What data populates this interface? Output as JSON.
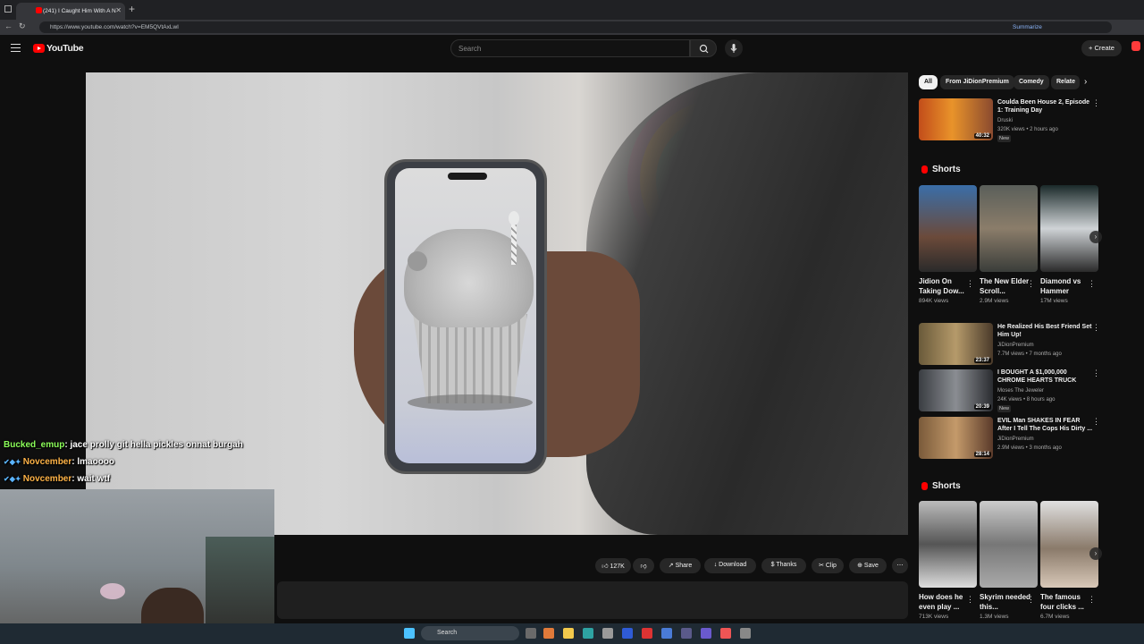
{
  "browser": {
    "tab_title": "(241) I Caught Him With A N",
    "url": "https://www.youtube.com/watch?v=EM5QVtAxLwI",
    "summarize_label": "Summarize"
  },
  "youtube": {
    "logo_text": "YouTube",
    "search_placeholder": "Search",
    "create_label": "Create"
  },
  "video_actions": {
    "like_count": "127K",
    "share": "Share",
    "download": "Download",
    "thanks": "Thanks",
    "clip": "Clip",
    "save": "Save"
  },
  "sidebar": {
    "chips": [
      "All",
      "From JiDionPremium",
      "Comedy",
      "Relate"
    ],
    "top_video": {
      "title": "Coulda Been House 2, Episode 1: Training Day",
      "channel": "Druski",
      "meta": "320K views • 2 hours ago",
      "badge": "New",
      "duration": "40:32"
    },
    "shorts_heading_1": "Shorts",
    "shorts_1": [
      {
        "title": "Jidion On Taking Dow...",
        "views": "894K views"
      },
      {
        "title": "The New Elder Scroll...",
        "views": "2.9M views"
      },
      {
        "title": "Diamond vs Hammer",
        "views": "17M views"
      }
    ],
    "videos": [
      {
        "title": "He Realized His Best Friend Set Him Up!",
        "channel": "JiDionPremium",
        "meta": "7.7M views • 7 months ago",
        "duration": "23:37",
        "badge": ""
      },
      {
        "title": "I BOUGHT A $1,000,000 CHROME HEARTS TRUCK",
        "channel": "Moses The Jeweler",
        "meta": "24K views • 8 hours ago",
        "duration": "20:39",
        "badge": "New"
      },
      {
        "title": "EVIL Man SHAKES IN FEAR After I Tell The Cops His Dirty ...",
        "channel": "JiDionPremium",
        "meta": "2.9M views • 3 months ago",
        "duration": "28:14",
        "badge": ""
      }
    ],
    "shorts_heading_2": "Shorts",
    "shorts_2": [
      {
        "title": "How does he even play ...",
        "views": "713K views"
      },
      {
        "title": "Skyrim needed this...",
        "views": "1.3M views"
      },
      {
        "title": "The famous four clicks ...",
        "views": "6.7M views"
      }
    ]
  },
  "chat": [
    {
      "user": "Bucked_emup",
      "message": ": jace prolly git hella pickles onnat burgah"
    },
    {
      "user": "Novcember",
      "message": ": lmaoooo"
    },
    {
      "user": "Novcember",
      "message": ": wait wtf"
    }
  ],
  "taskbar": {
    "search_label": "Search"
  }
}
